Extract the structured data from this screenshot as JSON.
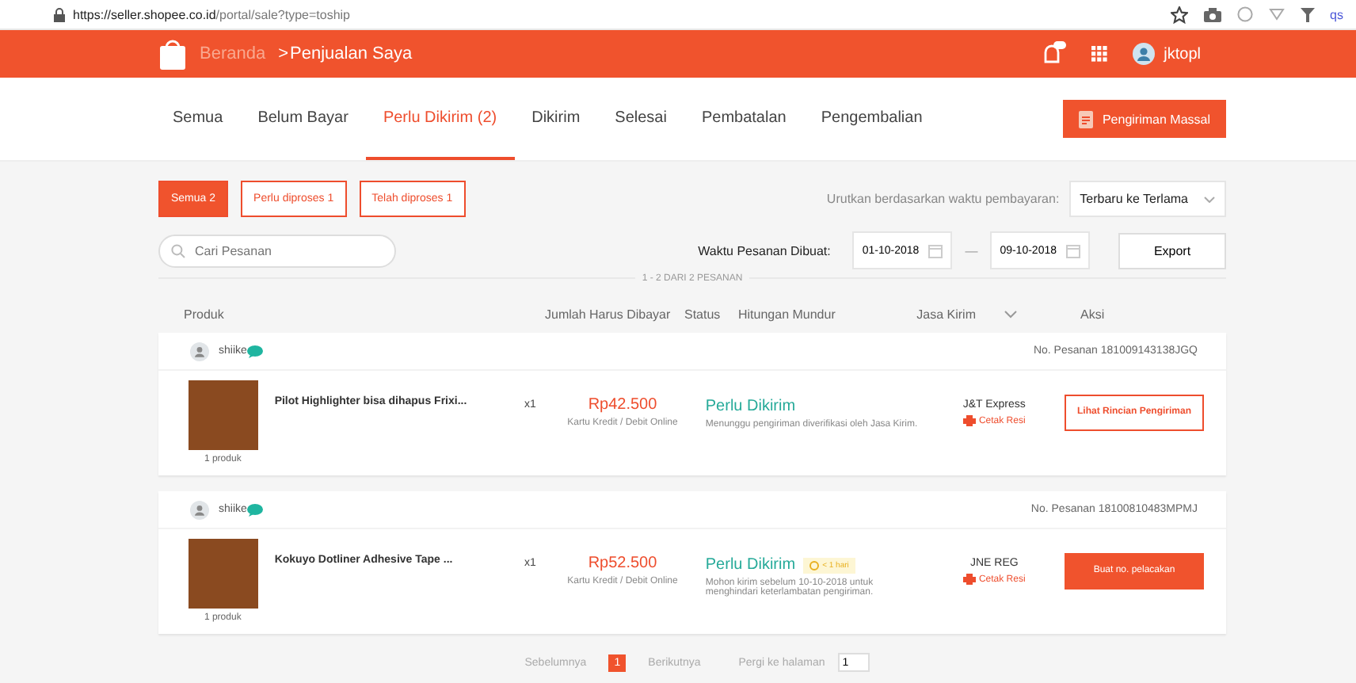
{
  "browser": {
    "url_host": "https://seller.shopee.co.id",
    "url_path": "/portal/sale?type=toship",
    "extension_label": "qs"
  },
  "header": {
    "home": "Beranda",
    "crumb_separator": ">",
    "current": "Penjualan Saya",
    "user": "jktopl"
  },
  "tabs": [
    {
      "label": "Semua",
      "selected": false
    },
    {
      "label": "Belum Bayar",
      "selected": false
    },
    {
      "label": "Perlu Dikirim (2)",
      "selected": true
    },
    {
      "label": "Dikirim",
      "selected": false
    },
    {
      "label": "Selesai",
      "selected": false
    },
    {
      "label": "Pembatalan",
      "selected": false
    },
    {
      "label": "Pengembalian",
      "selected": false
    }
  ],
  "mass_ship_button": "Pengiriman Massal",
  "filters": [
    {
      "label": "Semua 2",
      "selected": true
    },
    {
      "label": "Perlu diproses 1",
      "selected": false
    },
    {
      "label": "Telah diproses 1",
      "selected": false
    }
  ],
  "sort": {
    "label": "Urutkan berdasarkan waktu pembayaran:",
    "value": "Terbaru ke Terlama"
  },
  "search": {
    "placeholder": "Cari Pesanan"
  },
  "date_filter": {
    "label": "Waktu Pesanan Dibuat:",
    "from": "01-10-2018",
    "separator": "—",
    "to": "09-10-2018"
  },
  "export_button": "Export",
  "result_count": "1 - 2 DARI 2 PESANAN",
  "columns": [
    "Produk",
    "Jumlah Harus Dibayar",
    "Status",
    "Hitungan Mundur",
    "Jasa Kirim",
    "Aksi"
  ],
  "orders": [
    {
      "buyer": "shiike",
      "order_no": "No. Pesanan 181009143138JGQ",
      "product": "Pilot Highlighter bisa dihapus Frixi...",
      "product_count": "1 produk",
      "qty": "x1",
      "price": "Rp42.500",
      "payment": "Kartu Kredit / Debit Online",
      "status": "Perlu Dikirim",
      "note": "Menunggu pengiriman diverifikasi oleh Jasa Kirim.",
      "courier": "J&T Express",
      "print": "Cetak Resi",
      "action": {
        "label": "Lihat Rincian Pengiriman",
        "kind": "outline"
      }
    },
    {
      "buyer": "shiike",
      "order_no": "No. Pesanan 18100810483MPMJ",
      "product": "Kokuyo Dotliner Adhesive Tape ...",
      "product_count": "1 produk",
      "qty": "x1",
      "price": "Rp52.500",
      "payment": "Kartu Kredit / Debit Online",
      "status": "Perlu Dikirim",
      "countdown": "< 1 hari",
      "note": "Mohon kirim sebelum 10-10-2018 untuk menghindari keterlambatan pengiriman.",
      "courier": "JNE REG",
      "print": "Cetak Resi",
      "action": {
        "label": "Buat no. pelacakan",
        "kind": "solid"
      }
    }
  ],
  "pagination": {
    "prev": "Sebelumnya",
    "pages": [
      {
        "label": "1",
        "selected": true
      }
    ],
    "next": "Berikutnya",
    "goto": "Pergi ke halaman",
    "goto_value": "1"
  }
}
